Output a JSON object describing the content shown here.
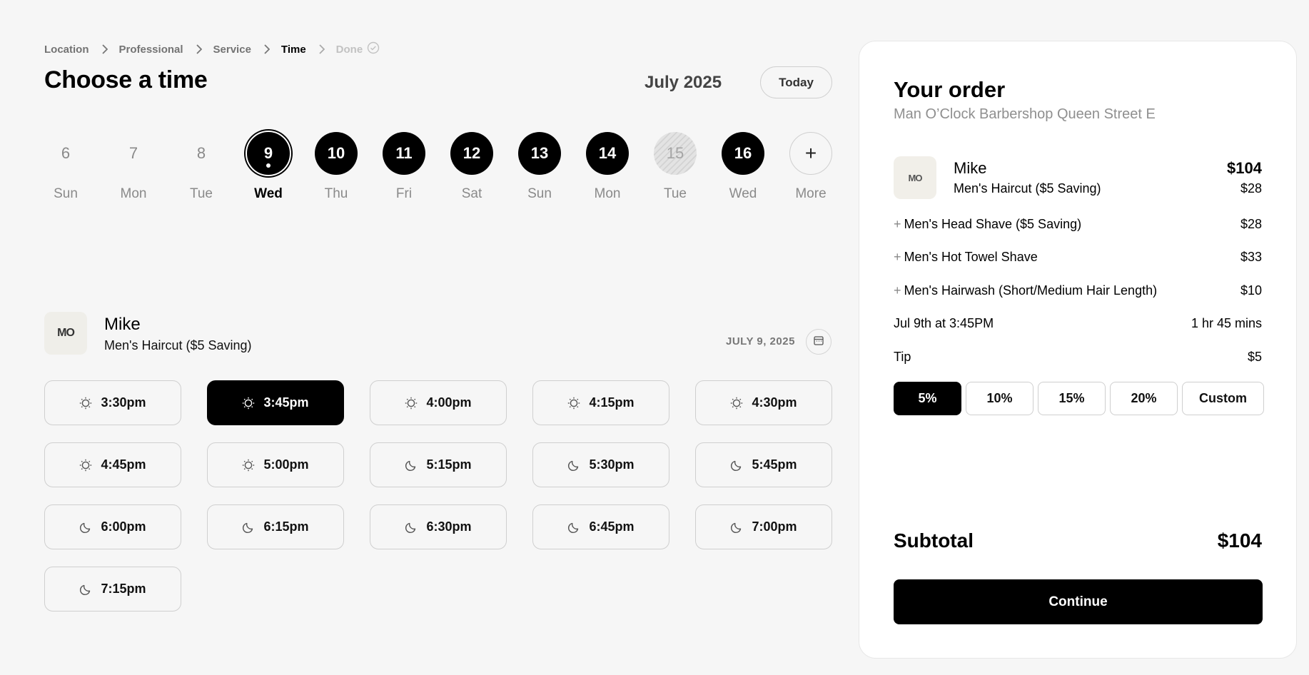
{
  "breadcrumb": [
    "Location",
    "Professional",
    "Service",
    "Time",
    "Done"
  ],
  "title": "Choose a time",
  "month": "July 2025",
  "today_label": "Today",
  "days": [
    {
      "num": "6",
      "name": "Sun",
      "state": "past"
    },
    {
      "num": "7",
      "name": "Mon",
      "state": "past"
    },
    {
      "num": "8",
      "name": "Tue",
      "state": "past"
    },
    {
      "num": "9",
      "name": "Wed",
      "state": "selected"
    },
    {
      "num": "10",
      "name": "Thu",
      "state": "avail"
    },
    {
      "num": "11",
      "name": "Fri",
      "state": "avail"
    },
    {
      "num": "12",
      "name": "Sat",
      "state": "avail"
    },
    {
      "num": "13",
      "name": "Sun",
      "state": "avail"
    },
    {
      "num": "14",
      "name": "Mon",
      "state": "avail"
    },
    {
      "num": "15",
      "name": "Tue",
      "state": "unavail"
    },
    {
      "num": "16",
      "name": "Wed",
      "state": "avail"
    },
    {
      "num": "+",
      "name": "More",
      "state": "more"
    }
  ],
  "professional": {
    "initials": "MO",
    "name": "Mike",
    "service": "Men's Haircut ($5 Saving)"
  },
  "date_label": "JULY 9, 2025",
  "slots": [
    {
      "time": "3:30pm",
      "icon": "sun-icon"
    },
    {
      "time": "3:45pm",
      "icon": "sun-icon",
      "selected": true
    },
    {
      "time": "4:00pm",
      "icon": "sun-icon"
    },
    {
      "time": "4:15pm",
      "icon": "sun-icon"
    },
    {
      "time": "4:30pm",
      "icon": "sun-icon"
    },
    {
      "time": "4:45pm",
      "icon": "sun-icon"
    },
    {
      "time": "5:00pm",
      "icon": "sun-icon"
    },
    {
      "time": "5:15pm",
      "icon": "moon-icon"
    },
    {
      "time": "5:30pm",
      "icon": "moon-icon"
    },
    {
      "time": "5:45pm",
      "icon": "moon-icon"
    },
    {
      "time": "6:00pm",
      "icon": "moon-icon"
    },
    {
      "time": "6:15pm",
      "icon": "moon-icon"
    },
    {
      "time": "6:30pm",
      "icon": "moon-icon"
    },
    {
      "time": "6:45pm",
      "icon": "moon-icon"
    },
    {
      "time": "7:00pm",
      "icon": "moon-icon"
    },
    {
      "time": "7:15pm",
      "icon": "moon-icon"
    }
  ],
  "order": {
    "title": "Your order",
    "shop": "Man O’Clock Barbershop Queen Street E",
    "pro_name": "Mike",
    "pro_total": "$104",
    "main_service": "Men's Haircut ($5 Saving)",
    "main_price": "$28",
    "addons": [
      {
        "label": "Men's Head Shave ($5 Saving)",
        "price": "$28"
      },
      {
        "label": "Men's Hot Towel Shave",
        "price": "$33"
      },
      {
        "label": "Men's Hairwash (Short/Medium Hair Length)",
        "price": "$10"
      }
    ],
    "when": "Jul 9th at 3:45PM",
    "duration": "1 hr 45 mins",
    "tip_label": "Tip",
    "tip_value": "$5",
    "tip_options": [
      "5%",
      "10%",
      "15%",
      "20%",
      "Custom"
    ],
    "tip_selected": "5%",
    "subtotal_label": "Subtotal",
    "subtotal_value": "$104",
    "continue_label": "Continue"
  }
}
